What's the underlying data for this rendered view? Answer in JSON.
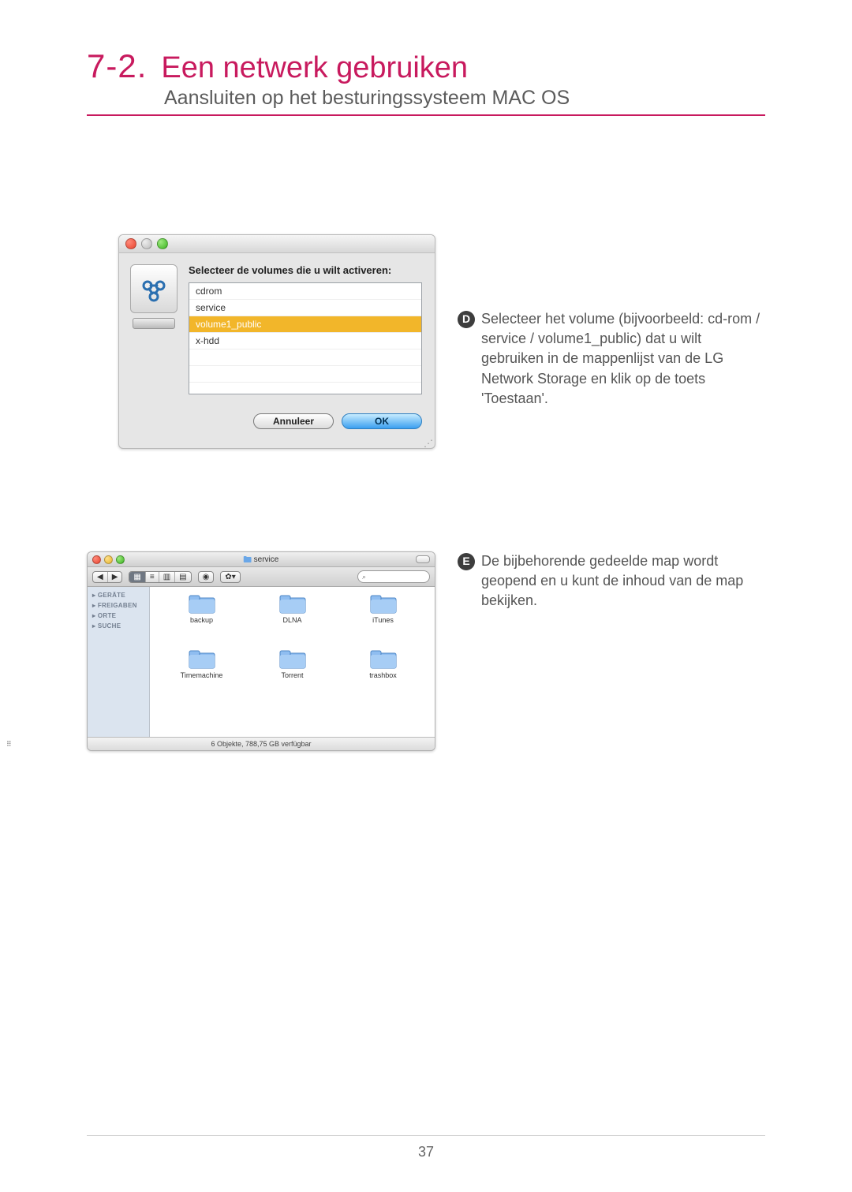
{
  "header": {
    "chapter_num": "7-2.",
    "title": "Een netwerk gebruiken",
    "subtitle": "Aansluiten op het besturingssysteem MAC OS"
  },
  "step_d": {
    "badge": "D",
    "text": "Selecteer het volume (bijvoorbeeld: cd-rom / service / volume1_public) dat u wilt gebruiken in de mappenlijst van de LG Network Storage en klik op de toets 'Toestaan'."
  },
  "step_e": {
    "badge": "E",
    "text": "De bijbehorende gedeelde map wordt geopend en u kunt de inhoud van de map bekijken."
  },
  "dialog": {
    "prompt": "Selecteer de volumes die u wilt activeren:",
    "volumes": [
      "cdrom",
      "service",
      "volume1_public",
      "x-hdd"
    ],
    "selected_index": 2,
    "buttons": {
      "cancel": "Annuleer",
      "ok": "OK"
    }
  },
  "finder": {
    "title": "service",
    "search_placeholder": "",
    "sidebar": [
      "GERÄTE",
      "FREIGABEN",
      "ORTE",
      "SUCHE"
    ],
    "folders": [
      "backup",
      "DLNA",
      "iTunes",
      "Timemachine",
      "Torrent",
      "trashbox"
    ],
    "status": "6 Objekte, 788,75 GB verfügbar"
  },
  "page_number": "37"
}
